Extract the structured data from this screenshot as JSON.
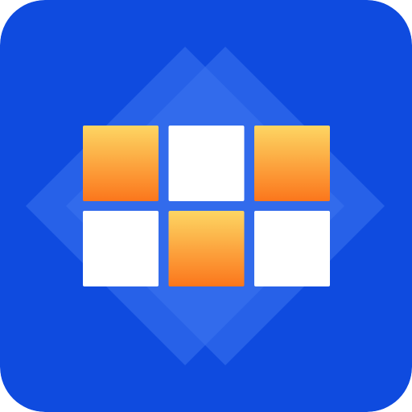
{
  "icon": {
    "name": "grid-tiles-app-icon",
    "colors": {
      "background": "#0f4bdf",
      "diamond_overlay": "#3c74ee",
      "tile_white": "#ffffff",
      "tile_gradient_top": "#fdd663",
      "tile_gradient_bottom": "#fb761c"
    },
    "grid": {
      "rows": [
        [
          "gradient",
          "white",
          "gradient"
        ],
        [
          "white",
          "gradient",
          "white"
        ]
      ]
    }
  }
}
